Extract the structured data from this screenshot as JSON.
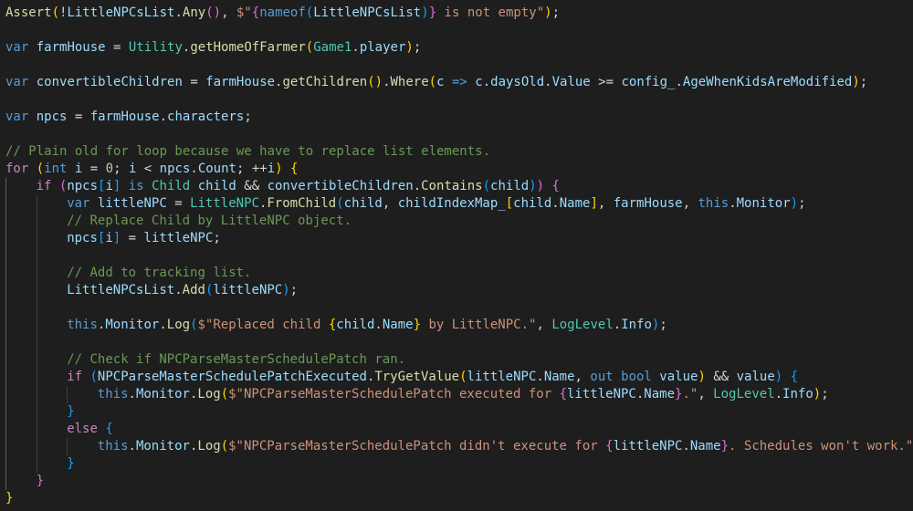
{
  "colors": {
    "background": "#1e1e1e",
    "keyword": "#569cd6",
    "control": "#c586c0",
    "function": "#dcdcaa",
    "type": "#4ec9b0",
    "variable": "#9cdcfe",
    "string": "#ce9178",
    "number": "#b5cea8",
    "comment": "#6a9955",
    "bracket_level1": "#ffd700",
    "bracket_level2": "#da70d6",
    "bracket_level3": "#179fff",
    "plain": "#d4d4d4"
  },
  "lines": [
    {
      "indent": 0,
      "tokens": [
        [
          "fn",
          "Assert"
        ],
        [
          "p1",
          "("
        ],
        [
          "pl",
          "!"
        ],
        [
          "var",
          "LittleNPCsList"
        ],
        [
          "pl",
          "."
        ],
        [
          "fn",
          "Any"
        ],
        [
          "p2",
          "()"
        ],
        [
          "pl",
          ", "
        ],
        [
          "str",
          "$\""
        ],
        [
          "p2",
          "{"
        ],
        [
          "kw",
          "nameof"
        ],
        [
          "p3",
          "("
        ],
        [
          "var",
          "LittleNPCsList"
        ],
        [
          "p3",
          ")"
        ],
        [
          "p2",
          "}"
        ],
        [
          "str",
          " is not empty\""
        ],
        [
          "p1",
          ")"
        ],
        [
          "pl",
          ";"
        ]
      ]
    },
    {
      "indent": 0,
      "tokens": []
    },
    {
      "indent": 0,
      "tokens": [
        [
          "kw",
          "var"
        ],
        [
          "pl",
          " "
        ],
        [
          "var",
          "farmHouse"
        ],
        [
          "pl",
          " = "
        ],
        [
          "ty",
          "Utility"
        ],
        [
          "pl",
          "."
        ],
        [
          "fn",
          "getHomeOfFarmer"
        ],
        [
          "p1",
          "("
        ],
        [
          "ty",
          "Game1"
        ],
        [
          "pl",
          "."
        ],
        [
          "var",
          "player"
        ],
        [
          "p1",
          ")"
        ],
        [
          "pl",
          ";"
        ]
      ]
    },
    {
      "indent": 0,
      "tokens": []
    },
    {
      "indent": 0,
      "tokens": [
        [
          "kw",
          "var"
        ],
        [
          "pl",
          " "
        ],
        [
          "var",
          "convertibleChildren"
        ],
        [
          "pl",
          " = "
        ],
        [
          "var",
          "farmHouse"
        ],
        [
          "pl",
          "."
        ],
        [
          "fn",
          "getChildren"
        ],
        [
          "p1",
          "()"
        ],
        [
          "pl",
          "."
        ],
        [
          "fn",
          "Where"
        ],
        [
          "p1",
          "("
        ],
        [
          "var",
          "c"
        ],
        [
          "pl",
          " "
        ],
        [
          "kw",
          "=>"
        ],
        [
          "pl",
          " "
        ],
        [
          "var",
          "c"
        ],
        [
          "pl",
          "."
        ],
        [
          "var",
          "daysOld"
        ],
        [
          "pl",
          "."
        ],
        [
          "var",
          "Value"
        ],
        [
          "pl",
          " >= "
        ],
        [
          "var",
          "config_"
        ],
        [
          "pl",
          "."
        ],
        [
          "var",
          "AgeWhenKidsAreModified"
        ],
        [
          "p1",
          ")"
        ],
        [
          "pl",
          ";"
        ]
      ]
    },
    {
      "indent": 0,
      "tokens": []
    },
    {
      "indent": 0,
      "tokens": [
        [
          "kw",
          "var"
        ],
        [
          "pl",
          " "
        ],
        [
          "var",
          "npcs"
        ],
        [
          "pl",
          " = "
        ],
        [
          "var",
          "farmHouse"
        ],
        [
          "pl",
          "."
        ],
        [
          "var",
          "characters"
        ],
        [
          "pl",
          ";"
        ]
      ]
    },
    {
      "indent": 0,
      "tokens": []
    },
    {
      "indent": 0,
      "tokens": [
        [
          "cm",
          "// Plain old for loop because we have to replace list elements."
        ]
      ]
    },
    {
      "indent": 0,
      "tokens": [
        [
          "ctrl",
          "for"
        ],
        [
          "pl",
          " "
        ],
        [
          "p1",
          "("
        ],
        [
          "kw",
          "int"
        ],
        [
          "pl",
          " "
        ],
        [
          "var",
          "i"
        ],
        [
          "pl",
          " = "
        ],
        [
          "num",
          "0"
        ],
        [
          "pl",
          "; "
        ],
        [
          "var",
          "i"
        ],
        [
          "pl",
          " < "
        ],
        [
          "var",
          "npcs"
        ],
        [
          "pl",
          "."
        ],
        [
          "var",
          "Count"
        ],
        [
          "pl",
          "; ++"
        ],
        [
          "var",
          "i"
        ],
        [
          "p1",
          ")"
        ],
        [
          "pl",
          " "
        ],
        [
          "p1",
          "{"
        ]
      ]
    },
    {
      "indent": 1,
      "tokens": [
        [
          "ctrl",
          "if"
        ],
        [
          "pl",
          " "
        ],
        [
          "p2",
          "("
        ],
        [
          "var",
          "npcs"
        ],
        [
          "p3",
          "["
        ],
        [
          "var",
          "i"
        ],
        [
          "p3",
          "]"
        ],
        [
          "pl",
          " "
        ],
        [
          "kw",
          "is"
        ],
        [
          "pl",
          " "
        ],
        [
          "ty",
          "Child"
        ],
        [
          "pl",
          " "
        ],
        [
          "var",
          "child"
        ],
        [
          "pl",
          " && "
        ],
        [
          "var",
          "convertibleChildren"
        ],
        [
          "pl",
          "."
        ],
        [
          "fn",
          "Contains"
        ],
        [
          "p3",
          "("
        ],
        [
          "var",
          "child"
        ],
        [
          "p3",
          ")"
        ],
        [
          "p2",
          ")"
        ],
        [
          "pl",
          " "
        ],
        [
          "p2",
          "{"
        ]
      ]
    },
    {
      "indent": 2,
      "tokens": [
        [
          "kw",
          "var"
        ],
        [
          "pl",
          " "
        ],
        [
          "var",
          "littleNPC"
        ],
        [
          "pl",
          " = "
        ],
        [
          "ty",
          "LittleNPC"
        ],
        [
          "pl",
          "."
        ],
        [
          "fn",
          "FromChild"
        ],
        [
          "p3",
          "("
        ],
        [
          "var",
          "child"
        ],
        [
          "pl",
          ", "
        ],
        [
          "var",
          "childIndexMap_"
        ],
        [
          "p1",
          "["
        ],
        [
          "var",
          "child"
        ],
        [
          "pl",
          "."
        ],
        [
          "var",
          "Name"
        ],
        [
          "p1",
          "]"
        ],
        [
          "pl",
          ", "
        ],
        [
          "var",
          "farmHouse"
        ],
        [
          "pl",
          ", "
        ],
        [
          "kw",
          "this"
        ],
        [
          "pl",
          "."
        ],
        [
          "var",
          "Monitor"
        ],
        [
          "p3",
          ")"
        ],
        [
          "pl",
          ";"
        ]
      ]
    },
    {
      "indent": 2,
      "tokens": [
        [
          "cm",
          "// Replace Child by LittleNPC object."
        ]
      ]
    },
    {
      "indent": 2,
      "tokens": [
        [
          "var",
          "npcs"
        ],
        [
          "p3",
          "["
        ],
        [
          "var",
          "i"
        ],
        [
          "p3",
          "]"
        ],
        [
          "pl",
          " = "
        ],
        [
          "var",
          "littleNPC"
        ],
        [
          "pl",
          ";"
        ]
      ]
    },
    {
      "indent": 2,
      "tokens": []
    },
    {
      "indent": 2,
      "tokens": [
        [
          "cm",
          "// Add to tracking list."
        ]
      ]
    },
    {
      "indent": 2,
      "tokens": [
        [
          "var",
          "LittleNPCsList"
        ],
        [
          "pl",
          "."
        ],
        [
          "fn",
          "Add"
        ],
        [
          "p3",
          "("
        ],
        [
          "var",
          "littleNPC"
        ],
        [
          "p3",
          ")"
        ],
        [
          "pl",
          ";"
        ]
      ]
    },
    {
      "indent": 2,
      "tokens": []
    },
    {
      "indent": 2,
      "tokens": [
        [
          "kw",
          "this"
        ],
        [
          "pl",
          "."
        ],
        [
          "var",
          "Monitor"
        ],
        [
          "pl",
          "."
        ],
        [
          "fn",
          "Log"
        ],
        [
          "p3",
          "("
        ],
        [
          "str",
          "$\"Replaced child "
        ],
        [
          "p1",
          "{"
        ],
        [
          "var",
          "child"
        ],
        [
          "pl",
          "."
        ],
        [
          "var",
          "Name"
        ],
        [
          "p1",
          "}"
        ],
        [
          "str",
          " by LittleNPC.\""
        ],
        [
          "pl",
          ", "
        ],
        [
          "ty",
          "LogLevel"
        ],
        [
          "pl",
          "."
        ],
        [
          "var",
          "Info"
        ],
        [
          "p3",
          ")"
        ],
        [
          "pl",
          ";"
        ]
      ]
    },
    {
      "indent": 2,
      "tokens": []
    },
    {
      "indent": 2,
      "tokens": [
        [
          "cm",
          "// Check if NPCParseMasterSchedulePatch ran."
        ]
      ]
    },
    {
      "indent": 2,
      "tokens": [
        [
          "ctrl",
          "if"
        ],
        [
          "pl",
          " "
        ],
        [
          "p3",
          "("
        ],
        [
          "var",
          "NPCParseMasterSchedulePatchExecuted"
        ],
        [
          "pl",
          "."
        ],
        [
          "fn",
          "TryGetValue"
        ],
        [
          "p1",
          "("
        ],
        [
          "var",
          "littleNPC"
        ],
        [
          "pl",
          "."
        ],
        [
          "var",
          "Name"
        ],
        [
          "pl",
          ", "
        ],
        [
          "kw",
          "out"
        ],
        [
          "pl",
          " "
        ],
        [
          "kw",
          "bool"
        ],
        [
          "pl",
          " "
        ],
        [
          "var",
          "value"
        ],
        [
          "p1",
          ")"
        ],
        [
          "pl",
          " && "
        ],
        [
          "var",
          "value"
        ],
        [
          "p3",
          ")"
        ],
        [
          "pl",
          " "
        ],
        [
          "p3",
          "{"
        ]
      ]
    },
    {
      "indent": 3,
      "tokens": [
        [
          "kw",
          "this"
        ],
        [
          "pl",
          "."
        ],
        [
          "var",
          "Monitor"
        ],
        [
          "pl",
          "."
        ],
        [
          "fn",
          "Log"
        ],
        [
          "p1",
          "("
        ],
        [
          "str",
          "$\"NPCParseMasterSchedulePatch executed for "
        ],
        [
          "p2",
          "{"
        ],
        [
          "var",
          "littleNPC"
        ],
        [
          "pl",
          "."
        ],
        [
          "var",
          "Name"
        ],
        [
          "p2",
          "}"
        ],
        [
          "str",
          ".\""
        ],
        [
          "pl",
          ", "
        ],
        [
          "ty",
          "LogLevel"
        ],
        [
          "pl",
          "."
        ],
        [
          "var",
          "Info"
        ],
        [
          "p1",
          ")"
        ],
        [
          "pl",
          ";"
        ]
      ]
    },
    {
      "indent": 2,
      "tokens": [
        [
          "p3",
          "}"
        ]
      ]
    },
    {
      "indent": 2,
      "tokens": [
        [
          "ctrl",
          "else"
        ],
        [
          "pl",
          " "
        ],
        [
          "p3",
          "{"
        ]
      ]
    },
    {
      "indent": 3,
      "tokens": [
        [
          "kw",
          "this"
        ],
        [
          "pl",
          "."
        ],
        [
          "var",
          "Monitor"
        ],
        [
          "pl",
          "."
        ],
        [
          "fn",
          "Log"
        ],
        [
          "p1",
          "("
        ],
        [
          "str",
          "$\"NPCParseMasterSchedulePatch didn't execute for "
        ],
        [
          "p2",
          "{"
        ],
        [
          "var",
          "littleNPC"
        ],
        [
          "pl",
          "."
        ],
        [
          "var",
          "Name"
        ],
        [
          "p2",
          "}"
        ],
        [
          "str",
          ". Schedules won't work.\""
        ]
      ]
    },
    {
      "indent": 2,
      "tokens": [
        [
          "p3",
          "}"
        ]
      ]
    },
    {
      "indent": 1,
      "tokens": [
        [
          "p2",
          "}"
        ]
      ]
    },
    {
      "indent": 0,
      "tokens": [
        [
          "p1",
          "}"
        ]
      ]
    }
  ]
}
